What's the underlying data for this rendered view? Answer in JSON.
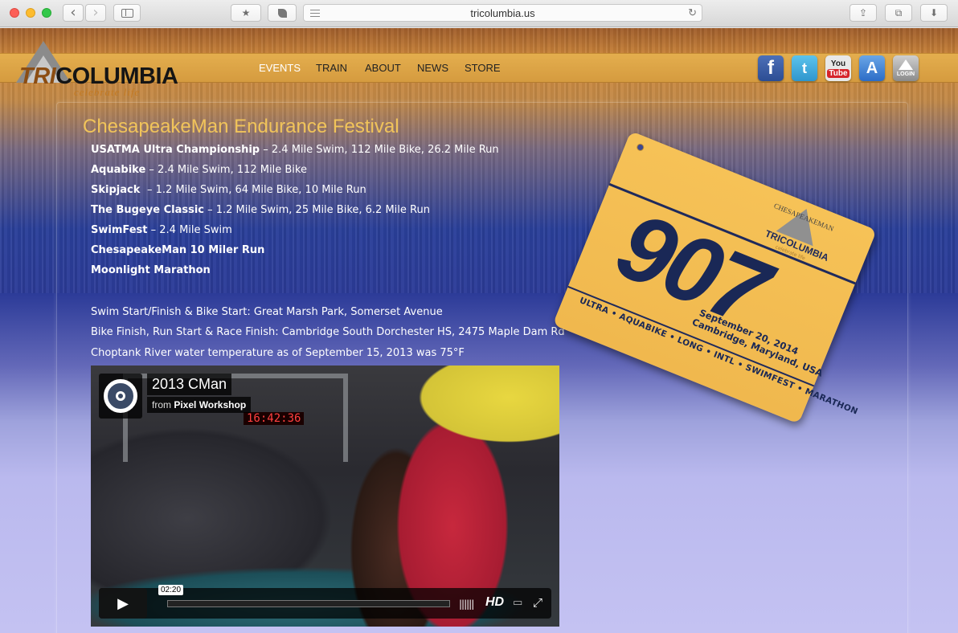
{
  "browser": {
    "url": "tricolumbia.us",
    "reload_glyph": "↻",
    "back_glyph": "‹",
    "forward_glyph": "›",
    "bookmark_glyph": "★",
    "share_glyph": "⇪",
    "tabs_glyph": "⧉",
    "download_glyph": "⬇",
    "colors": {
      "close": "#fc5f57",
      "minimize": "#fdbc2e",
      "zoom": "#34c84a"
    }
  },
  "site": {
    "logo_tri": "TRI",
    "logo_columbia": "COLUMBIA",
    "logo_tagline": "celebrate life",
    "nav": [
      "EVENTS",
      "TRAIN",
      "ABOUT",
      "NEWS",
      "STORE"
    ],
    "social": {
      "facebook": "f",
      "twitter": "t",
      "youtube_you": "You",
      "youtube_tube": "Tube",
      "appstore": "A",
      "login": "LOGIN"
    }
  },
  "content": {
    "title": "ChesapeakeMan Endurance Festival",
    "events": [
      {
        "name": "USATMA Ultra Championship",
        "detail": " – 2.4 Mile Swim, 112 Mile Bike, 26.2 Mile Run"
      },
      {
        "name": "Aquabike",
        "detail": " – 2.4 Mile Swim, 112 Mile Bike"
      },
      {
        "name": "Skipjack ",
        "detail": " – 1.2 Mile Swim, 64 Mile Bike, 10 Mile Run"
      },
      {
        "name": "The Bugeye Classic",
        "detail": " – 1.2 Mile Swim, 25 Mile Bike, 6.2 Mile Run"
      },
      {
        "name": "SwimFest",
        "detail": " – 2.4 Mile Swim"
      },
      {
        "name": "ChesapeakeMan 10 Miler Run",
        "detail": ""
      },
      {
        "name": "Moonlight Marathon",
        "detail": ""
      }
    ],
    "info": [
      "Swim Start/Finish & Bike Start: Great Marsh Park, Somerset Avenue",
      "Bike Finish, Run Start & Race Finish: Cambridge South Dorchester HS, 2475 Maple Dam Rd",
      "Choptank River water temperature as of September 15, 2013 was 75°F"
    ]
  },
  "bib": {
    "logo_top": "CHESAPEAKEMAN",
    "logo_brand": "TRICOLUMBIA",
    "logo_tagline": "celebrate life",
    "number": "907",
    "date": "September 20, 2014",
    "place": "Cambridge, Maryland, USA",
    "races": "ULTRA • AQUABIKE • LONG • INTL • SWIMFEST • MARATHON"
  },
  "video": {
    "title": "2013 CMan",
    "from_prefix": "from ",
    "from_author": "Pixel Workshop",
    "clock": "16:42:36",
    "time_tip": "02:20",
    "play_glyph": "▶",
    "volume_glyph": "||||||",
    "hd_label": "HD",
    "airplay_glyph": "▭",
    "fullscreen_glyph": "⤢"
  }
}
